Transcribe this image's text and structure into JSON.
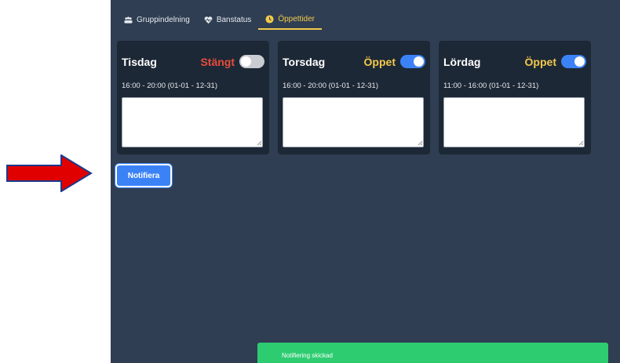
{
  "tabs": [
    {
      "label": "Gruppindelning",
      "icon": "group-icon",
      "active": false
    },
    {
      "label": "Banstatus",
      "icon": "heart-pulse-icon",
      "active": false
    },
    {
      "label": "Öppettider",
      "icon": "clock-icon",
      "active": true
    }
  ],
  "cards": [
    {
      "day": "Tisdag",
      "status": "Stängt",
      "open": false,
      "hours": "16:00 - 20:00  (01-01 - 12-31)"
    },
    {
      "day": "Torsdag",
      "status": "Öppet",
      "open": true,
      "hours": "16:00 - 20:00  (01-01 - 12-31)"
    },
    {
      "day": "Lördag",
      "status": "Öppet",
      "open": true,
      "hours": "11:00 - 16:00  (01-01 - 12-31)"
    }
  ],
  "notify_button": "Notifiera",
  "toast": "Notifiering skickad",
  "colors": {
    "background": "#2f3e52",
    "card": "#1d2836",
    "accent": "#f2c94c",
    "closed": "#e74c3c",
    "toggle_on": "#3b82f6",
    "toast": "#2ecc71",
    "arrow": "#e10000"
  }
}
